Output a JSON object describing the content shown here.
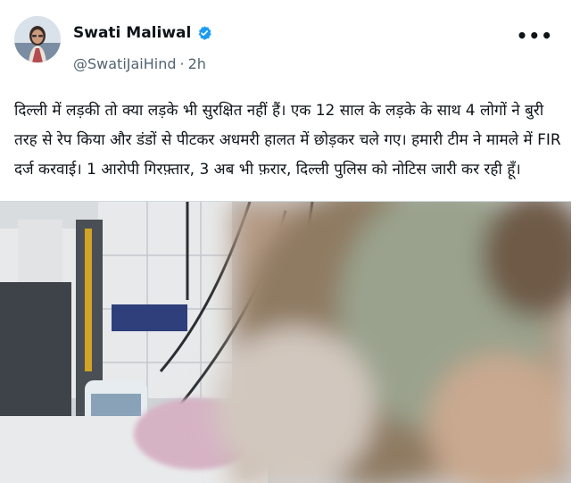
{
  "author": {
    "display_name": "Swati Maliwal",
    "handle": "@SwatiJaiHind",
    "separator": "·",
    "time_ago": "2h",
    "verified": true,
    "verified_color": "#1d9bf0"
  },
  "menu": {
    "more_label": "•••"
  },
  "tweet": {
    "text": "दिल्ली में लड़की तो क्या लड़के भी सुरक्षित नहीं हैं। एक 12 साल के लड़के के साथ 4 लोगों ने बुरी तरह से रेप किया और डंडों से पीटकर अधमरी हालत में छोड़कर चले गए। हमारी टीम ने मामले में FIR दर्ज करवाई। 1 आरोपी गिरफ़्तार, 3 अब भी फ़रार, दिल्ली पुलिस को नोटिस जारी कर रही हूँ।"
  },
  "media": {
    "kind": "blurred-hospital-photo"
  }
}
